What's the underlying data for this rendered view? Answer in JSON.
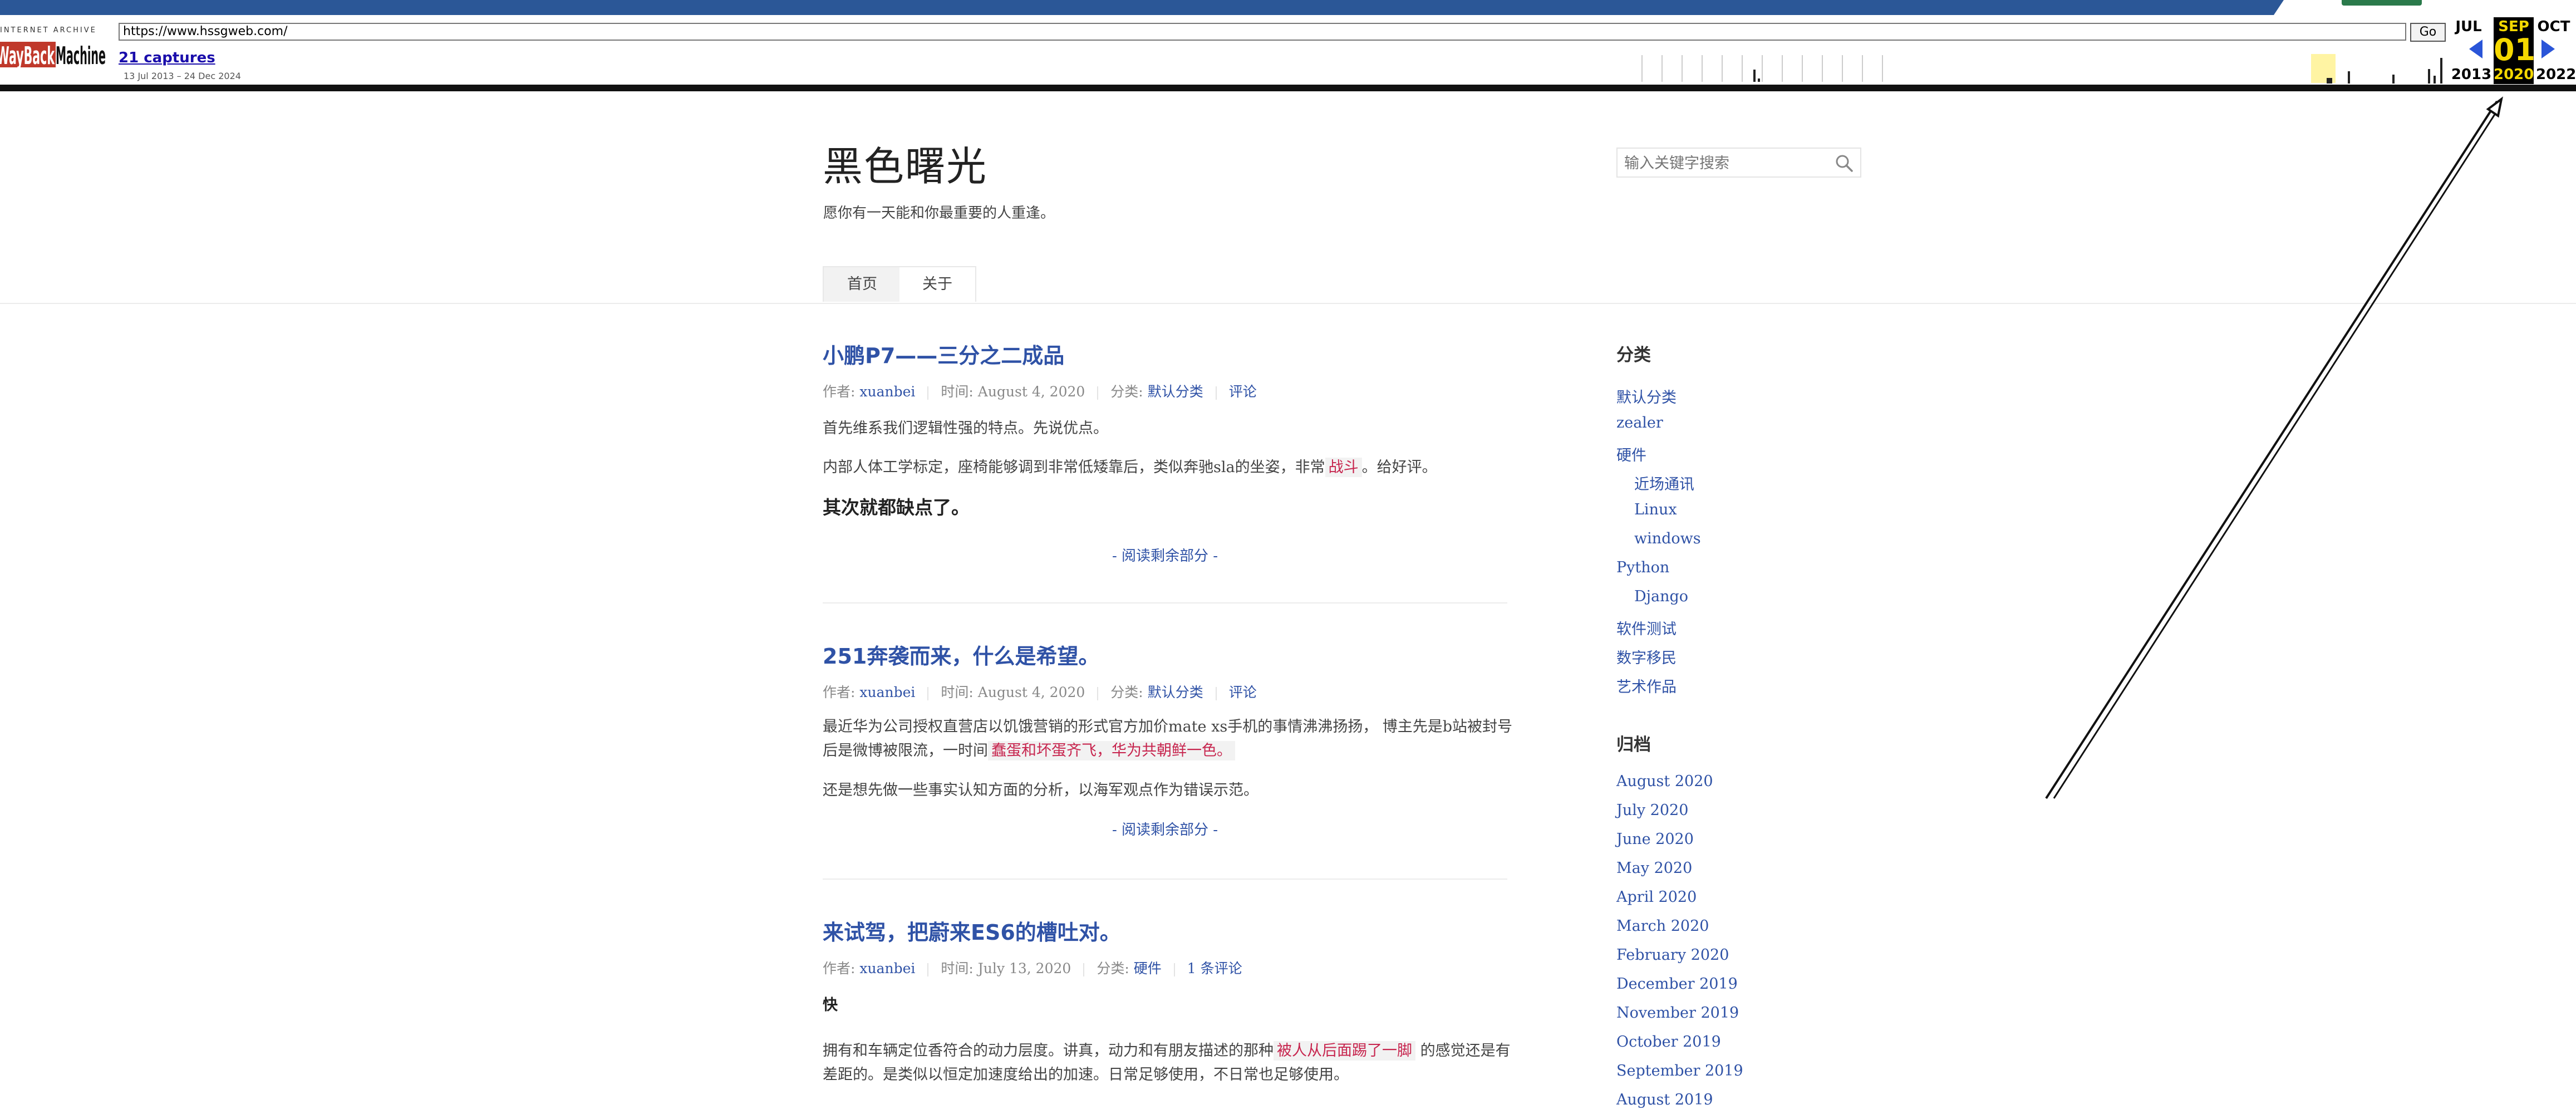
{
  "wayback": {
    "logo_top": "INTERNET ARCHIVE",
    "logo": "WaybackMachine",
    "url": "https://www.hssgweb.com/",
    "go_label": "Go",
    "captures": "21 captures",
    "range": "13 Jul 2013 – 24 Dec 2024",
    "prev_month": "JUL",
    "cur_month": "SEP",
    "next_month": "OCT",
    "prev_year": "2013",
    "cur_day": "01",
    "cur_year": "2020",
    "next_year": "2022",
    "accent": "#2a55d8",
    "highlight": "#f5d800"
  },
  "site": {
    "title": "黑色曙光",
    "description": "愿你有一天能和你最重要的人重逢。",
    "search_placeholder": "输入关键字搜索",
    "nav": [
      "首页",
      "关于"
    ]
  },
  "posts": [
    {
      "title": "小鹏P7——三分之二成品",
      "author_label": "作者:",
      "author": "xuanbei",
      "time_label": "时间:",
      "time": "August 4, 2020",
      "category_label": "分类:",
      "category": "默认分类",
      "comments": "评论",
      "p1": "首先维系我们逻辑性强的特点。先说优点。",
      "p2_a": "内部人体工学标定，座椅能够调到非常低矮靠后，类似奔驰sla的坐姿，非常",
      "p2_hl": "战斗",
      "p2_b": "。给好评。",
      "p3": "其次就都缺点了。",
      "more": "- 阅读剩余部分 -"
    },
    {
      "title": "251奔袭而来，什么是希望。",
      "author_label": "作者:",
      "author": "xuanbei",
      "time_label": "时间:",
      "time": "August 4, 2020",
      "category_label": "分类:",
      "category": "默认分类",
      "comments": "评论",
      "p1_a": "最近华为公司授权直营店以饥饿营销的形式官方加价mate xs手机的事情沸沸扬扬，  博主先是b站被封号后是微博被限流，一时间",
      "p1_hl": "蠢蛋和坏蛋齐飞，华为共朝鲜一色。",
      "p2": "还是想先做一些事实认知方面的分析，以海军观点作为错误示范。",
      "more": "- 阅读剩余部分 -"
    },
    {
      "title": "来试驾，把蔚来ES6的槽吐对。",
      "author_label": "作者:",
      "author": "xuanbei",
      "time_label": "时间:",
      "time": "July 13, 2020",
      "category_label": "分类:",
      "category": "硬件",
      "comments": "1 条评论",
      "p1": "快",
      "p2_a": "拥有和车辆定位香符合的动力层度。讲真，动力和有朋友描述的那种",
      "p2_hl": "被人从后面踢了一脚",
      "p2_b": "的感觉还是有差距的。是类似以恒定加速度给出的加速。日常足够使用，不日常也足够使用。"
    }
  ],
  "sidebar": {
    "categories_title": "分类",
    "categories": [
      {
        "label": "默认分类",
        "level": 0
      },
      {
        "label": "zealer",
        "level": 0
      },
      {
        "label": "硬件",
        "level": 0
      },
      {
        "label": "近场通讯",
        "level": 1
      },
      {
        "label": "Linux",
        "level": 1
      },
      {
        "label": "windows",
        "level": 1
      },
      {
        "label": "Python",
        "level": 0
      },
      {
        "label": "Django",
        "level": 1
      },
      {
        "label": "软件测试",
        "level": 0
      },
      {
        "label": "数字移民",
        "level": 0
      },
      {
        "label": "艺术作品",
        "level": 0
      }
    ],
    "archive_title": "归档",
    "archive": [
      "August 2020",
      "July 2020",
      "June 2020",
      "May 2020",
      "April 2020",
      "March 2020",
      "February 2020",
      "December 2019",
      "November 2019",
      "October 2019",
      "September 2019",
      "August 2019"
    ]
  },
  "colors": {
    "link": "#2f52a6",
    "highlight_text": "#c7254e",
    "topbar": "#2b5797"
  }
}
